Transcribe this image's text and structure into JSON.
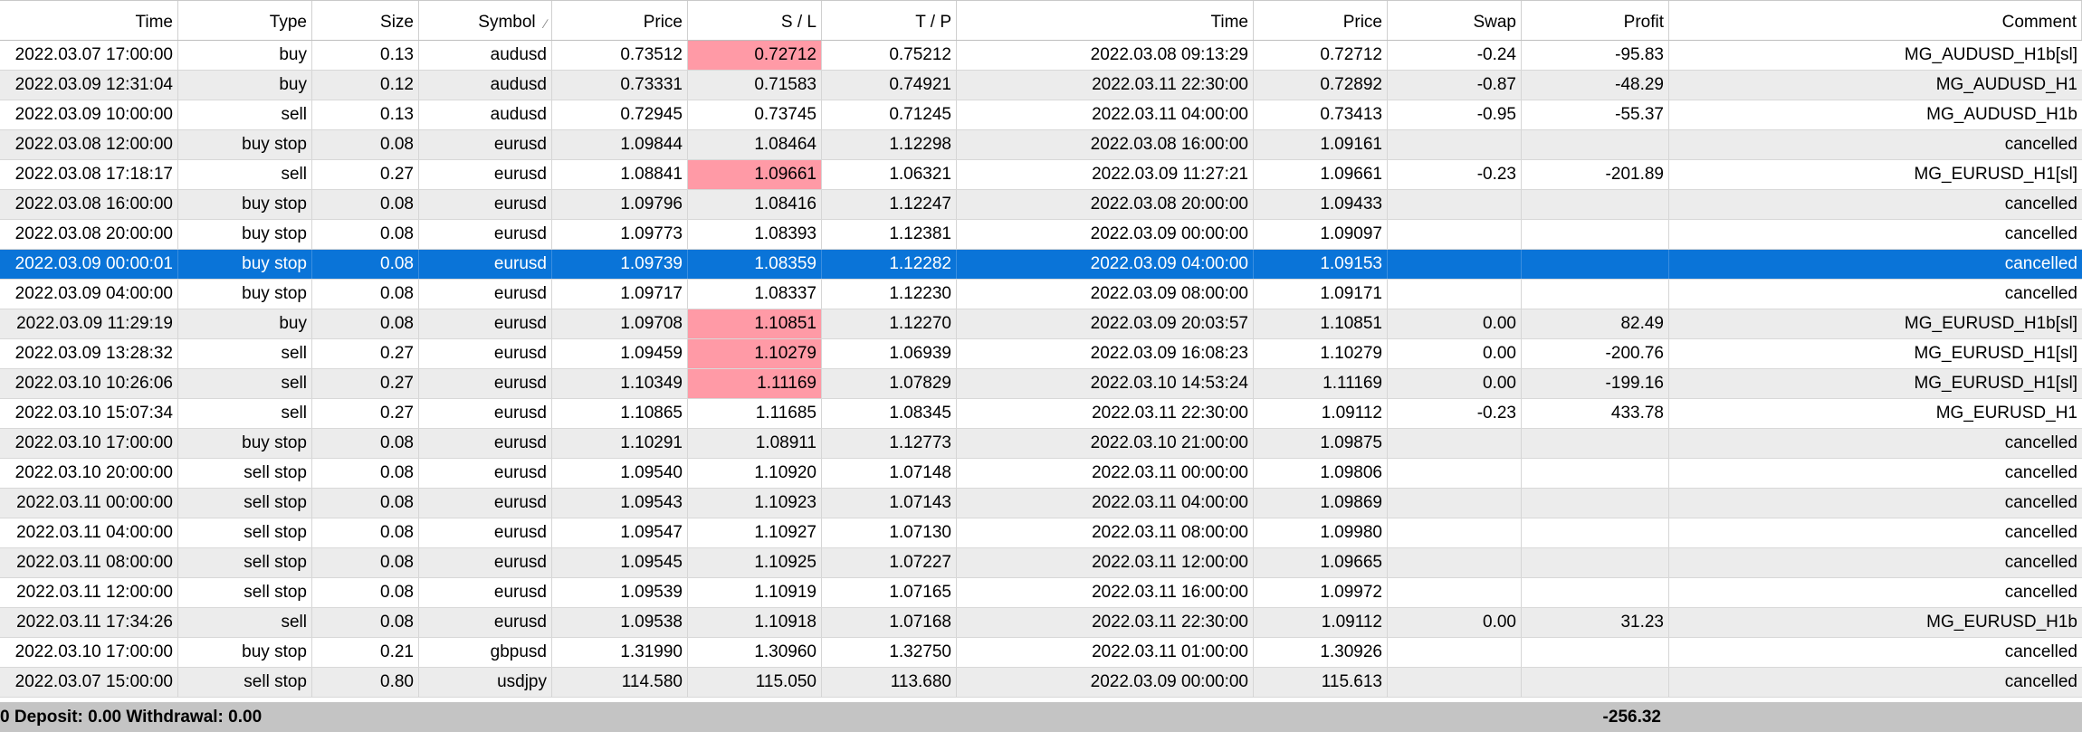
{
  "columns": [
    "Time",
    "Type",
    "Size",
    "Symbol",
    "Price",
    "S / L",
    "T / P",
    "Time",
    "Price",
    "Swap",
    "Profit",
    "Comment"
  ],
  "sorted_column": "Symbol",
  "highlight_color": "#ff9aa6",
  "selection_color": "#0a74d8",
  "rows": [
    {
      "cells": [
        "2022.03.07 17:00:00",
        "buy",
        "0.13",
        "audusd",
        "0.73512",
        "0.72712",
        "0.75212",
        "2022.03.08 09:13:29",
        "0.72712",
        "-0.24",
        "-95.83",
        "MG_AUDUSD_H1b[sl]"
      ],
      "sl_hit": true
    },
    {
      "cells": [
        "2022.03.09 12:31:04",
        "buy",
        "0.12",
        "audusd",
        "0.73331",
        "0.71583",
        "0.74921",
        "2022.03.11 22:30:00",
        "0.72892",
        "-0.87",
        "-48.29",
        "MG_AUDUSD_H1"
      ],
      "sl_hit": false
    },
    {
      "cells": [
        "2022.03.09 10:00:00",
        "sell",
        "0.13",
        "audusd",
        "0.72945",
        "0.73745",
        "0.71245",
        "2022.03.11 04:00:00",
        "0.73413",
        "-0.95",
        "-55.37",
        "MG_AUDUSD_H1b"
      ],
      "sl_hit": false
    },
    {
      "cells": [
        "2022.03.08 12:00:00",
        "buy stop",
        "0.08",
        "eurusd",
        "1.09844",
        "1.08464",
        "1.12298",
        "2022.03.08 16:00:00",
        "1.09161",
        "",
        "",
        "cancelled"
      ],
      "sl_hit": false
    },
    {
      "cells": [
        "2022.03.08 17:18:17",
        "sell",
        "0.27",
        "eurusd",
        "1.08841",
        "1.09661",
        "1.06321",
        "2022.03.09 11:27:21",
        "1.09661",
        "-0.23",
        "-201.89",
        "MG_EURUSD_H1[sl]"
      ],
      "sl_hit": true
    },
    {
      "cells": [
        "2022.03.08 16:00:00",
        "buy stop",
        "0.08",
        "eurusd",
        "1.09796",
        "1.08416",
        "1.12247",
        "2022.03.08 20:00:00",
        "1.09433",
        "",
        "",
        "cancelled"
      ],
      "sl_hit": false
    },
    {
      "cells": [
        "2022.03.08 20:00:00",
        "buy stop",
        "0.08",
        "eurusd",
        "1.09773",
        "1.08393",
        "1.12381",
        "2022.03.09 00:00:00",
        "1.09097",
        "",
        "",
        "cancelled"
      ],
      "sl_hit": false
    },
    {
      "cells": [
        "2022.03.09 00:00:01",
        "buy stop",
        "0.08",
        "eurusd",
        "1.09739",
        "1.08359",
        "1.12282",
        "2022.03.09 04:00:00",
        "1.09153",
        "",
        "",
        "cancelled"
      ],
      "sl_hit": false,
      "selected": true
    },
    {
      "cells": [
        "2022.03.09 04:00:00",
        "buy stop",
        "0.08",
        "eurusd",
        "1.09717",
        "1.08337",
        "1.12230",
        "2022.03.09 08:00:00",
        "1.09171",
        "",
        "",
        "cancelled"
      ],
      "sl_hit": false
    },
    {
      "cells": [
        "2022.03.09 11:29:19",
        "buy",
        "0.08",
        "eurusd",
        "1.09708",
        "1.10851",
        "1.12270",
        "2022.03.09 20:03:57",
        "1.10851",
        "0.00",
        "82.49",
        "MG_EURUSD_H1b[sl]"
      ],
      "sl_hit": true
    },
    {
      "cells": [
        "2022.03.09 13:28:32",
        "sell",
        "0.27",
        "eurusd",
        "1.09459",
        "1.10279",
        "1.06939",
        "2022.03.09 16:08:23",
        "1.10279",
        "0.00",
        "-200.76",
        "MG_EURUSD_H1[sl]"
      ],
      "sl_hit": true
    },
    {
      "cells": [
        "2022.03.10 10:26:06",
        "sell",
        "0.27",
        "eurusd",
        "1.10349",
        "1.11169",
        "1.07829",
        "2022.03.10 14:53:24",
        "1.11169",
        "0.00",
        "-199.16",
        "MG_EURUSD_H1[sl]"
      ],
      "sl_hit": true
    },
    {
      "cells": [
        "2022.03.10 15:07:34",
        "sell",
        "0.27",
        "eurusd",
        "1.10865",
        "1.11685",
        "1.08345",
        "2022.03.11 22:30:00",
        "1.09112",
        "-0.23",
        "433.78",
        "MG_EURUSD_H1"
      ],
      "sl_hit": false
    },
    {
      "cells": [
        "2022.03.10 17:00:00",
        "buy stop",
        "0.08",
        "eurusd",
        "1.10291",
        "1.08911",
        "1.12773",
        "2022.03.10 21:00:00",
        "1.09875",
        "",
        "",
        "cancelled"
      ],
      "sl_hit": false
    },
    {
      "cells": [
        "2022.03.10 20:00:00",
        "sell stop",
        "0.08",
        "eurusd",
        "1.09540",
        "1.10920",
        "1.07148",
        "2022.03.11 00:00:00",
        "1.09806",
        "",
        "",
        "cancelled"
      ],
      "sl_hit": false
    },
    {
      "cells": [
        "2022.03.11 00:00:00",
        "sell stop",
        "0.08",
        "eurusd",
        "1.09543",
        "1.10923",
        "1.07143",
        "2022.03.11 04:00:00",
        "1.09869",
        "",
        "",
        "cancelled"
      ],
      "sl_hit": false
    },
    {
      "cells": [
        "2022.03.11 04:00:00",
        "sell stop",
        "0.08",
        "eurusd",
        "1.09547",
        "1.10927",
        "1.07130",
        "2022.03.11 08:00:00",
        "1.09980",
        "",
        "",
        "cancelled"
      ],
      "sl_hit": false
    },
    {
      "cells": [
        "2022.03.11 08:00:00",
        "sell stop",
        "0.08",
        "eurusd",
        "1.09545",
        "1.10925",
        "1.07227",
        "2022.03.11 12:00:00",
        "1.09665",
        "",
        "",
        "cancelled"
      ],
      "sl_hit": false
    },
    {
      "cells": [
        "2022.03.11 12:00:00",
        "sell stop",
        "0.08",
        "eurusd",
        "1.09539",
        "1.10919",
        "1.07165",
        "2022.03.11 16:00:00",
        "1.09972",
        "",
        "",
        "cancelled"
      ],
      "sl_hit": false
    },
    {
      "cells": [
        "2022.03.11 17:34:26",
        "sell",
        "0.08",
        "eurusd",
        "1.09538",
        "1.10918",
        "1.07168",
        "2022.03.11 22:30:00",
        "1.09112",
        "0.00",
        "31.23",
        "MG_EURUSD_H1b"
      ],
      "sl_hit": false
    },
    {
      "cells": [
        "2022.03.10 17:00:00",
        "buy stop",
        "0.21",
        "gbpusd",
        "1.31990",
        "1.30960",
        "1.32750",
        "2022.03.11 01:00:00",
        "1.30926",
        "",
        "",
        "cancelled"
      ],
      "sl_hit": false
    },
    {
      "cells": [
        "2022.03.07 15:00:00",
        "sell stop",
        "0.80",
        "usdjpy",
        "114.580",
        "115.050",
        "113.680",
        "2022.03.09 00:00:00",
        "115.613",
        "",
        "",
        "cancelled"
      ],
      "sl_hit": false
    }
  ],
  "footer": {
    "summary": "0  Deposit: 0.00  Withdrawal: 0.00",
    "total_profit": "-256.32"
  }
}
